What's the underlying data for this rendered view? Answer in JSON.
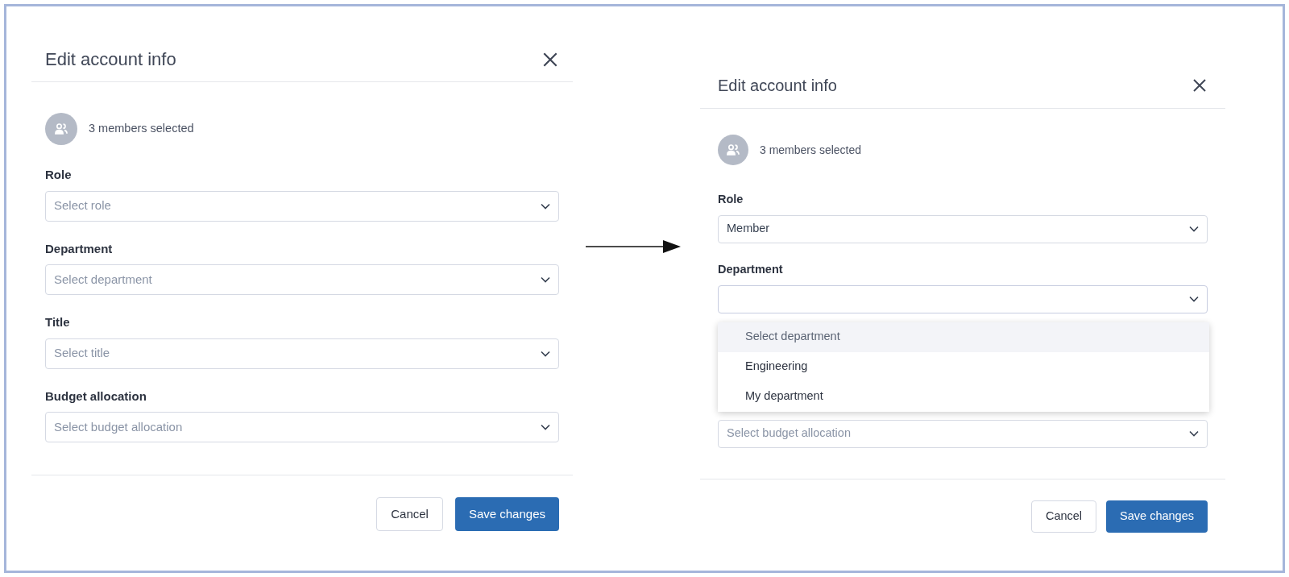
{
  "dialogs": [
    {
      "title": "Edit account info",
      "members_text": "3 members selected",
      "fields": [
        {
          "label": "Role",
          "placeholder": "Select role"
        },
        {
          "label": "Department",
          "placeholder": "Select department"
        },
        {
          "label": "Title",
          "placeholder": "Select title"
        },
        {
          "label": "Budget allocation",
          "placeholder": "Select budget allocation"
        }
      ],
      "buttons": [
        {
          "label": "Cancel",
          "kind": "secondary"
        },
        {
          "label": "Save changes",
          "kind": "primary"
        }
      ]
    },
    {
      "title": "Edit account info",
      "members_text": "3 members selected",
      "fields": [
        {
          "label": "Role",
          "value": "Member"
        },
        {
          "label": "Department",
          "expanded": true,
          "options": [
            {
              "label": "Select department",
              "highlighted": true
            },
            {
              "label": "Engineering",
              "highlighted": false
            },
            {
              "label": "My department",
              "highlighted": false
            }
          ]
        },
        {
          "placeholder": "Select budget allocation"
        }
      ],
      "buttons": [
        {
          "label": "Cancel",
          "kind": "secondary"
        },
        {
          "label": "Save changes",
          "kind": "primary"
        }
      ]
    }
  ]
}
